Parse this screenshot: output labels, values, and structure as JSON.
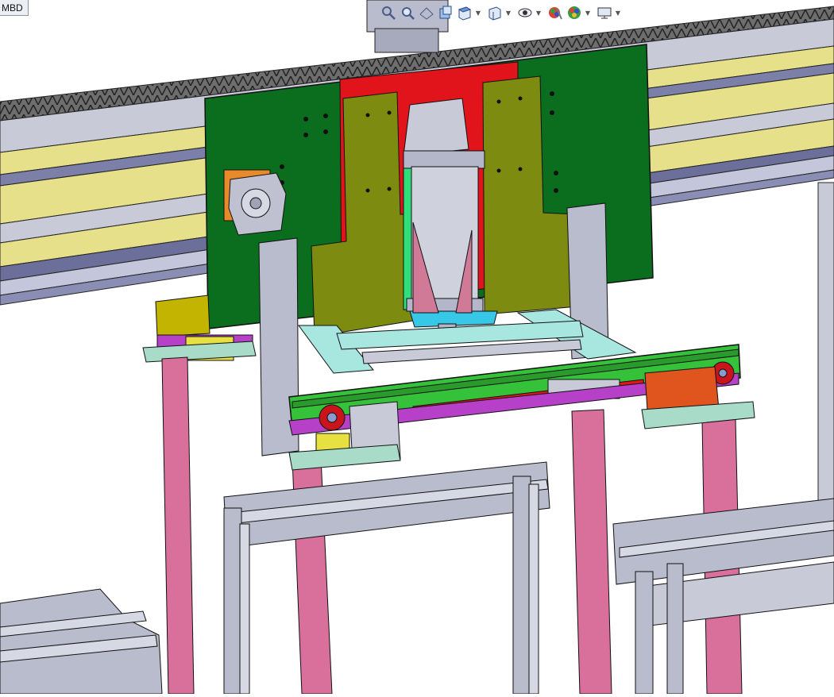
{
  "document_tab": {
    "label": "MBD"
  },
  "toolbar": {
    "buttons": [
      {
        "icon": "zoom-to-fit-icon"
      },
      {
        "icon": "zoom-to-area-icon"
      },
      {
        "icon": "previous-view-icon"
      },
      {
        "icon": "section-view-icon"
      },
      {
        "icon": "view-orientation-icon",
        "dropdown": true
      },
      {
        "icon": "display-style-icon",
        "dropdown": true
      },
      {
        "icon": "hide-show-items-icon",
        "dropdown": true
      },
      {
        "icon": "edit-appearance-icon"
      },
      {
        "icon": "apply-scene-icon",
        "dropdown": true
      },
      {
        "icon": "view-settings-icon",
        "dropdown": true
      }
    ]
  },
  "colors": {
    "mount_plate": "#0a6e1e",
    "red_plate": "#e0141a",
    "olive_plate": "#7d8c10",
    "frame_leg": "#d9709c",
    "cyan_frame": "#a8e6e0",
    "steel": "#b9bccc",
    "rail_yellow": "#e6e08a",
    "conveyor_green": "#35c23a",
    "orange_block": "#e0541e"
  }
}
